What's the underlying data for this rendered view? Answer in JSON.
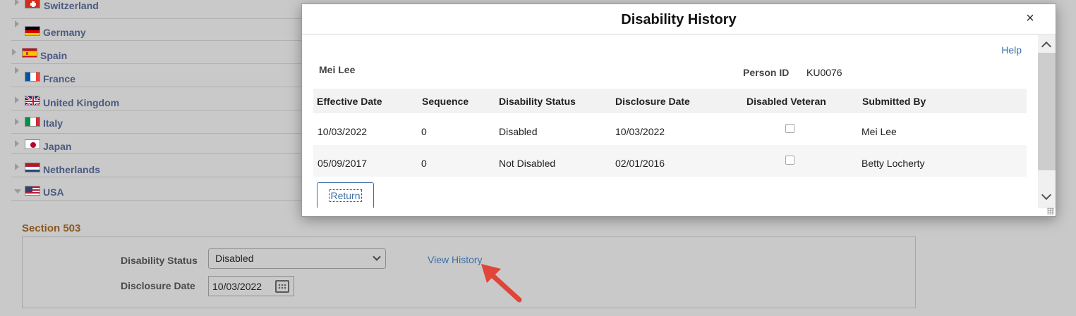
{
  "countries": [
    {
      "name": "Switzerland",
      "expanded": false,
      "flag": "switzerland-flag-icon"
    },
    {
      "name": "Germany",
      "expanded": false,
      "flag": "germany-flag-icon"
    },
    {
      "name": "Spain",
      "expanded": false,
      "flag": "spain-flag-icon"
    },
    {
      "name": "France",
      "expanded": false,
      "flag": "france-flag-icon"
    },
    {
      "name": "United Kingdom",
      "expanded": false,
      "flag": "uk-flag-icon"
    },
    {
      "name": "Italy",
      "expanded": false,
      "flag": "italy-flag-icon"
    },
    {
      "name": "Japan",
      "expanded": false,
      "flag": "japan-flag-icon"
    },
    {
      "name": "Netherlands",
      "expanded": false,
      "flag": "netherlands-flag-icon"
    },
    {
      "name": "USA",
      "expanded": true,
      "flag": "usa-flag-icon"
    }
  ],
  "section": {
    "title": "Section 503",
    "disability_status_label": "Disability Status",
    "disability_status_value": "Disabled",
    "disclosure_date_label": "Disclosure Date",
    "disclosure_date_value": "10/03/2022",
    "view_history_link": "View History"
  },
  "modal": {
    "title": "Disability History",
    "close_icon": "×",
    "help_link": "Help",
    "person_name": "Mei Lee",
    "person_id_label": "Person ID",
    "person_id_value": "KU0076",
    "columns": [
      "Effective Date",
      "Sequence",
      "Disability Status",
      "Disclosure Date",
      "Disabled Veteran",
      "Submitted By"
    ],
    "rows": [
      {
        "effective_date": "10/03/2022",
        "sequence": "0",
        "disability_status": "Disabled",
        "disclosure_date": "10/03/2022",
        "disabled_veteran": false,
        "submitted_by": "Mei Lee"
      },
      {
        "effective_date": "05/09/2017",
        "sequence": "0",
        "disability_status": "Not Disabled",
        "disclosure_date": "02/01/2016",
        "disabled_veteran": false,
        "submitted_by": "Betty Locherty"
      }
    ],
    "return_button": "Return"
  },
  "colors": {
    "link": "#3d6fa8",
    "section_title": "#8a5a22",
    "country_name": "#4a5a82",
    "overlay_gray": "#c9c9c9",
    "annotation_arrow": "#e0453a"
  }
}
